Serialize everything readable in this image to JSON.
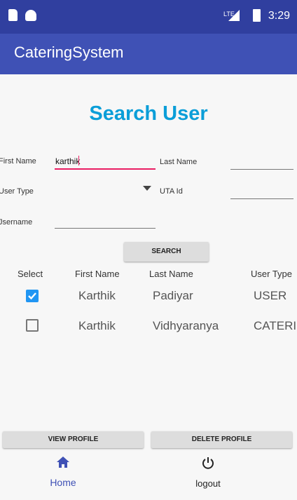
{
  "status_bar": {
    "time": "3:29",
    "network": "LTE"
  },
  "app_bar": {
    "title": "CateringSystem"
  },
  "page": {
    "heading": "Search User"
  },
  "form": {
    "first_name_label": "First Name",
    "first_name_value": "karthik",
    "last_name_label": "Last Name",
    "last_name_value": "",
    "user_type_label": "User Type",
    "user_type_value": "",
    "uta_id_label": "UTA Id",
    "uta_id_value": "",
    "username_label": "Jsername",
    "username_value": "",
    "search_label": "SEARCH"
  },
  "table": {
    "headers": [
      "Select",
      "First Name",
      "Last Name",
      "User Type"
    ],
    "rows": [
      {
        "checked": true,
        "first_name": "Karthik",
        "last_name": "Padiyar",
        "user_type": "USER"
      },
      {
        "checked": false,
        "first_name": "Karthik",
        "last_name": "Vidhyaranya",
        "user_type": "CATERI"
      }
    ]
  },
  "actions": {
    "view_profile_label": "VIEW PROFILE",
    "delete_profile_label": "DELETE PROFILE"
  },
  "bottom_nav": {
    "items": [
      {
        "label": "Home",
        "icon": "home-icon",
        "active": true
      },
      {
        "label": "logout",
        "icon": "power-icon",
        "active": false
      }
    ]
  },
  "colors": {
    "primary": "#3f51b5",
    "primary_dark": "#303f9f",
    "accent": "#e91e63",
    "heading": "#0b9ed8",
    "checkbox": "#2196f3"
  }
}
